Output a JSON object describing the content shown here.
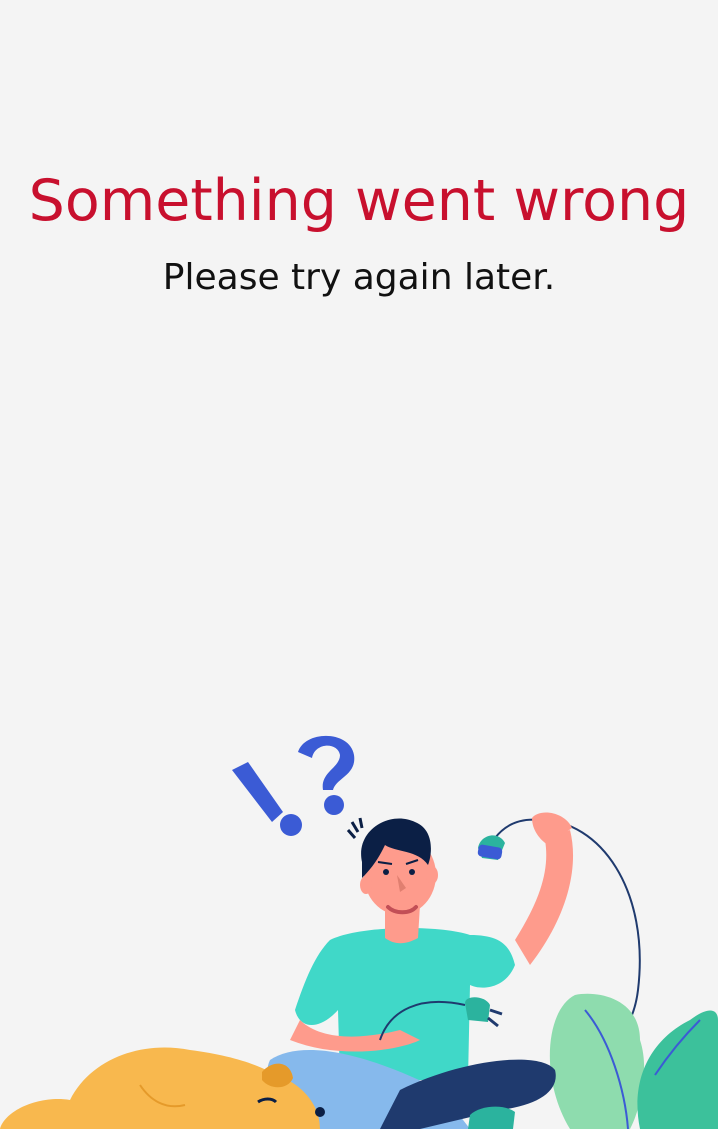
{
  "error": {
    "title": "Something went wrong",
    "message": "Please try again later."
  },
  "colors": {
    "background": "#f4f4f4",
    "title": "#c8102e",
    "message": "#111111",
    "accent_blue": "#3b5bd5",
    "shirt": "#40d8c8",
    "skin": "#fe9b8c",
    "dog": "#f8b84e",
    "plant": "#8edcae"
  },
  "illustration": {
    "subject": "person-holding-unplugged-cable-with-dog-and-plant",
    "symbols": [
      "!",
      "?"
    ]
  }
}
